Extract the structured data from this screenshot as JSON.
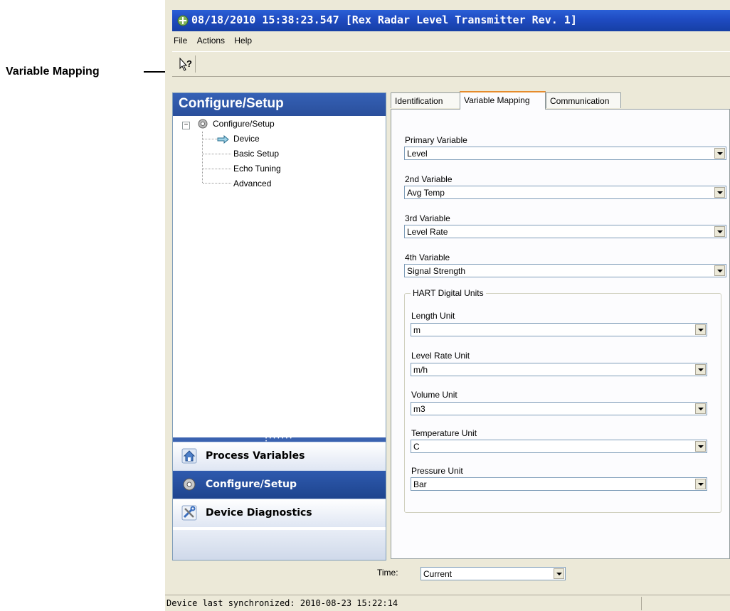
{
  "annotation": {
    "label": "Variable Mapping"
  },
  "window": {
    "title": "08/18/2010 15:38:23.547 [Rex Radar Level Transmitter Rev. 1]",
    "menu": [
      "File",
      "Actions",
      "Help"
    ],
    "toolbar": {
      "help_icon": "whats-this-help-icon"
    }
  },
  "left_pane": {
    "header": "Configure/Setup",
    "tree": {
      "root": "Configure/Setup",
      "items": [
        "Device",
        "Basic Setup",
        "Echo Tuning",
        "Advanced"
      ],
      "selected": "Device"
    },
    "nav": [
      {
        "label": "Process Variables",
        "icon": "home-icon",
        "active": false
      },
      {
        "label": "Configure/Setup",
        "icon": "gear-icon",
        "active": true
      },
      {
        "label": "Device Diagnostics",
        "icon": "tools-icon",
        "active": false
      }
    ]
  },
  "tabs": [
    "Identification",
    "Variable Mapping",
    "Communication"
  ],
  "selected_tab": "Variable Mapping",
  "variables": [
    {
      "label": "Primary Variable",
      "value": "Level"
    },
    {
      "label": "2nd Variable",
      "value": "Avg Temp"
    },
    {
      "label": "3rd Variable",
      "value": "Level Rate"
    },
    {
      "label": "4th Variable",
      "value": "Signal Strength"
    }
  ],
  "hart_units": {
    "title": "HART Digital Units",
    "fields": [
      {
        "label": "Length Unit",
        "value": "m"
      },
      {
        "label": "Level Rate Unit",
        "value": "m/h"
      },
      {
        "label": "Volume Unit",
        "value": "m3"
      },
      {
        "label": "Temperature Unit",
        "value": "C"
      },
      {
        "label": "Pressure Unit",
        "value": "Bar"
      }
    ]
  },
  "time": {
    "label": "Time:",
    "value": "Current"
  },
  "status": {
    "text": "Device last synchronized: 2010-08-23 15:22:14"
  },
  "colors": {
    "accent": "#2a4f9b",
    "title_bar": "#1f4bc1",
    "tab_highlight": "#e68b2c"
  }
}
